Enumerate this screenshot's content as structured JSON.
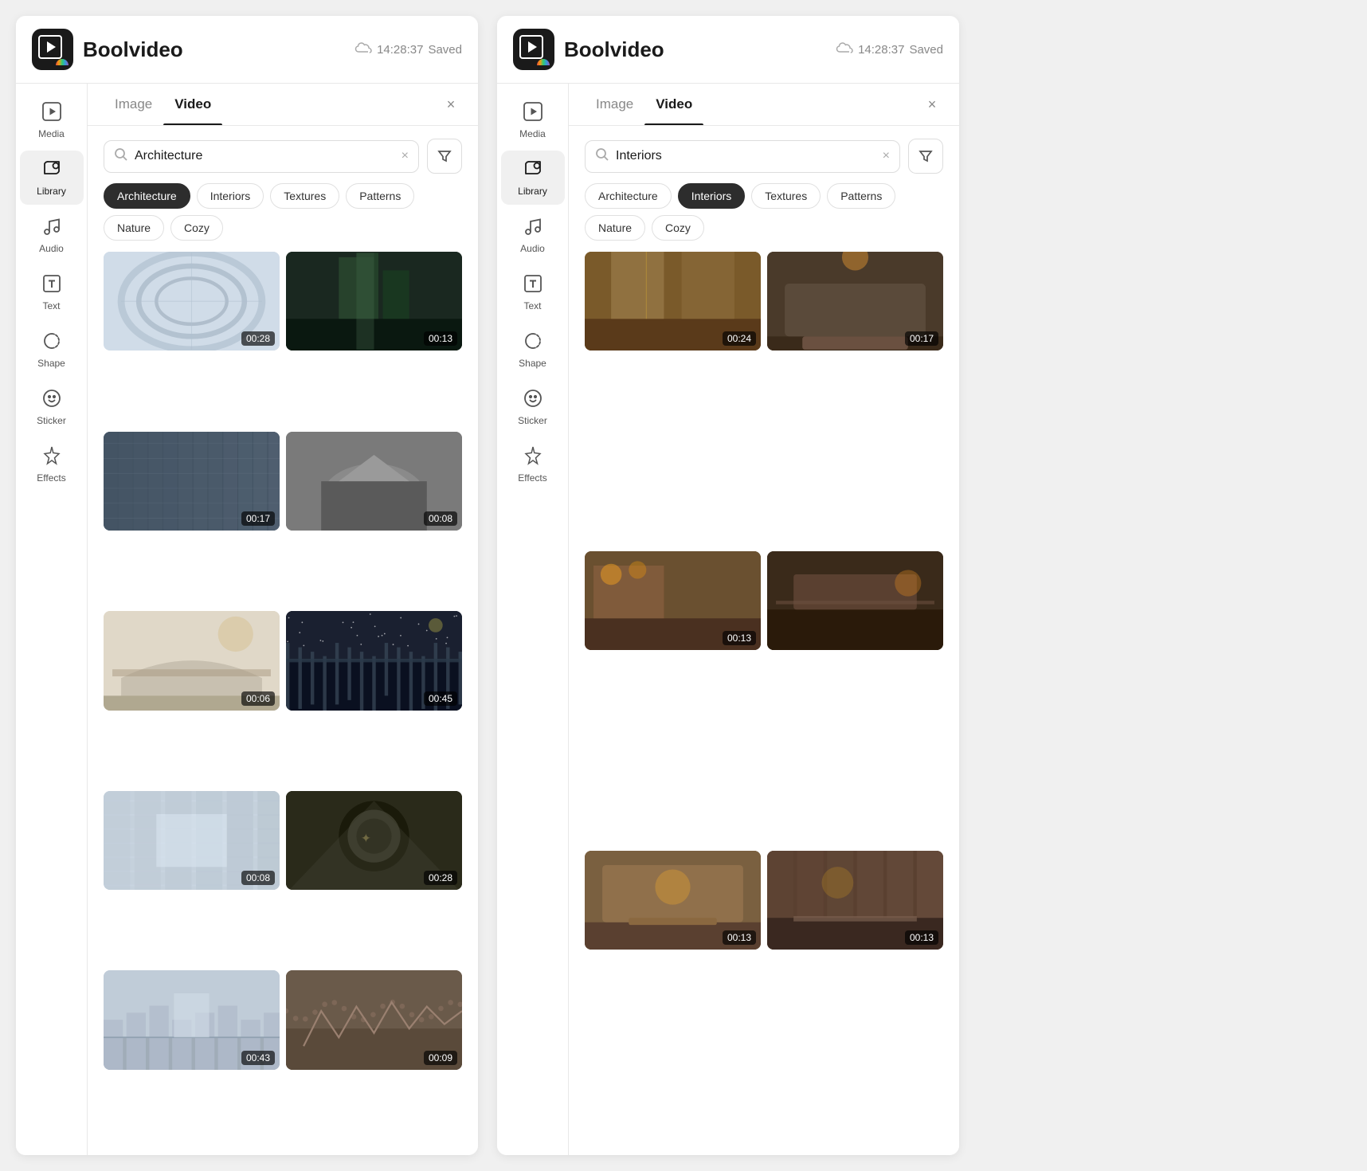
{
  "panels": [
    {
      "id": "panel-left",
      "header": {
        "title": "Boolvideo",
        "timestamp": "14:28:37",
        "status": "Saved"
      },
      "tabs": [
        {
          "id": "image",
          "label": "Image",
          "active": false
        },
        {
          "id": "video",
          "label": "Video",
          "active": true
        }
      ],
      "sidebar": {
        "items": [
          {
            "id": "media",
            "label": "Media",
            "icon": "media",
            "active": false
          },
          {
            "id": "library",
            "label": "Library",
            "icon": "library",
            "active": true
          },
          {
            "id": "audio",
            "label": "Audio",
            "icon": "audio",
            "active": false
          },
          {
            "id": "text",
            "label": "Text",
            "icon": "text",
            "active": false
          },
          {
            "id": "shape",
            "label": "Shape",
            "icon": "shape",
            "active": false
          },
          {
            "id": "sticker",
            "label": "Sticker",
            "icon": "sticker",
            "active": false
          },
          {
            "id": "effects",
            "label": "Effects",
            "icon": "effects",
            "active": false
          }
        ]
      },
      "search": {
        "value": "Architecture",
        "placeholder": "Search"
      },
      "tags": [
        {
          "label": "Architecture",
          "active": true
        },
        {
          "label": "Interiors",
          "active": false
        },
        {
          "label": "Textures",
          "active": false
        },
        {
          "label": "Patterns",
          "active": false
        },
        {
          "label": "Nature",
          "active": false
        },
        {
          "label": "Cozy",
          "active": false
        }
      ],
      "videos": [
        {
          "duration": "00:28",
          "bg": "vt-1"
        },
        {
          "duration": "00:13",
          "bg": "vt-2"
        },
        {
          "duration": "00:17",
          "bg": "vt-3"
        },
        {
          "duration": "00:08",
          "bg": "vt-4"
        },
        {
          "duration": "00:06",
          "bg": "vt-5"
        },
        {
          "duration": "00:45",
          "bg": "vt-6"
        },
        {
          "duration": "00:08",
          "bg": "vt-7"
        },
        {
          "duration": "00:28",
          "bg": "vt-8"
        },
        {
          "duration": "00:43",
          "bg": "vt-9"
        },
        {
          "duration": "00:09",
          "bg": "vt-10"
        }
      ]
    },
    {
      "id": "panel-right",
      "header": {
        "title": "Boolvideo",
        "timestamp": "14:28:37",
        "status": "Saved"
      },
      "tabs": [
        {
          "id": "image",
          "label": "Image",
          "active": false
        },
        {
          "id": "video",
          "label": "Video",
          "active": true
        }
      ],
      "sidebar": {
        "items": [
          {
            "id": "media",
            "label": "Media",
            "icon": "media",
            "active": false
          },
          {
            "id": "library",
            "label": "Library",
            "icon": "library",
            "active": true
          },
          {
            "id": "audio",
            "label": "Audio",
            "icon": "audio",
            "active": false
          },
          {
            "id": "text",
            "label": "Text",
            "icon": "text",
            "active": false
          },
          {
            "id": "shape",
            "label": "Shape",
            "icon": "shape",
            "active": false
          },
          {
            "id": "sticker",
            "label": "Sticker",
            "icon": "sticker",
            "active": false
          },
          {
            "id": "effects",
            "label": "Effects",
            "icon": "effects",
            "active": false
          }
        ]
      },
      "search": {
        "value": "Interiors",
        "placeholder": "Search"
      },
      "tags": [
        {
          "label": "Architecture",
          "active": false
        },
        {
          "label": "Interiors",
          "active": true
        },
        {
          "label": "Textures",
          "active": false
        },
        {
          "label": "Patterns",
          "active": false
        },
        {
          "label": "Nature",
          "active": false
        },
        {
          "label": "Cozy",
          "active": false
        }
      ],
      "videos": [
        {
          "duration": "00:24",
          "bg": "vi-1"
        },
        {
          "duration": "00:17",
          "bg": "vi-2"
        },
        {
          "duration": "00:13",
          "bg": "vi-3"
        },
        {
          "duration": "",
          "bg": "vi-4"
        },
        {
          "duration": "00:13",
          "bg": "vi-5"
        },
        {
          "duration": "00:13",
          "bg": "vi-6"
        }
      ]
    }
  ],
  "icons": {
    "media": "▶",
    "library": "⊞",
    "audio": "♩",
    "text": "T",
    "shape": "⬡",
    "sticker": "◎",
    "effects": "✦",
    "cloud": "☁",
    "search": "⌕",
    "filter": "⋈",
    "close": "×"
  }
}
